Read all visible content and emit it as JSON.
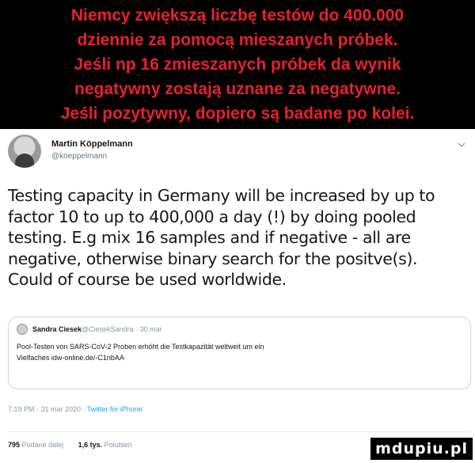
{
  "banner": {
    "lines": [
      "Niemcy zwiększą liczbę testów do 400.000",
      "dziennie za pomocą mieszanych próbek.",
      "Jeśli np 16 zmieszanych próbek da wynik",
      "negatywny zostają uznane za negatywne.",
      "Jeśli pozytywny, dopiero są badane po kolei."
    ],
    "text_color": "#e8212b"
  },
  "tweet": {
    "author_name": "Martin Köppelmann",
    "author_handle": "@koeppelmann",
    "avatar_icon": "user-avatar",
    "menu_icon": "chevron-down-icon",
    "text_lines": [
      "Testing capacity in Germany will be increased by up to",
      "factor 10 to up to 400,000 a day (!) by doing pooled",
      "testing. E.g mix 16 samples and if negative - all are",
      "negative, otherwise binary search for the positve(s).",
      "Could of course be used worldwide."
    ],
    "quote": {
      "name": "Sandra Ciesek",
      "meta": "@CiesekSandra · 30 mar",
      "text_lines": [
        "Pool-Testen von SARS-CoV-2 Proben erhöht die Testkapazität weltweit um ein",
        "Vielfaches idw-online.de/-C1nbAA"
      ]
    },
    "timestamp": "7:19 PM · 31 mar 2020 · ",
    "source": "Twitter for iPhone",
    "stats": {
      "retweets_count": "795",
      "retweets_label": "Podane dalej",
      "likes_count": "1,6 tys.",
      "likes_label": "Polubień"
    },
    "accent_color": "#1da1f2"
  },
  "watermark": {
    "text": "mdupiu.pl"
  }
}
